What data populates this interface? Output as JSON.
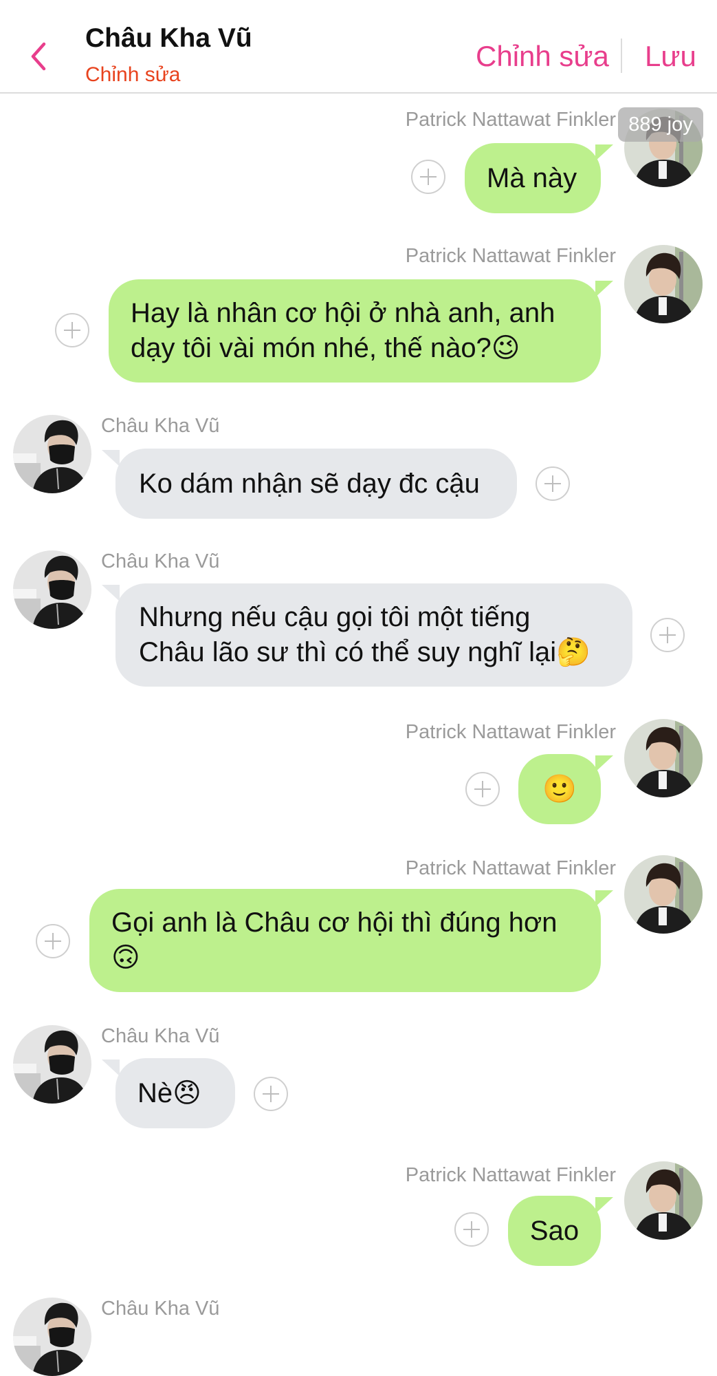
{
  "header": {
    "back_icon": "chevron-left-icon",
    "title": "Châu Kha Vũ",
    "subtitle": "Chỉnh sửa",
    "edit_label": "Chỉnh sửa",
    "save_label": "Lưu",
    "accent_color": "#e83e8c",
    "subtitle_color": "#e8431e"
  },
  "colors": {
    "bubble_self": "#bdf08d",
    "bubble_other": "#e6e8eb",
    "sender_name": "#9a9a9a"
  },
  "watermark": "889 joy",
  "messages": [
    {
      "side": "right",
      "sender": "Patrick Nattawat Finkler",
      "text": "Mà này"
    },
    {
      "side": "right",
      "sender": "Patrick Nattawat Finkler",
      "lines": [
        "Hay là nhân cơ hội ở nhà anh,  anh",
        "dạy tôi vài món nhé, thế nào?😉"
      ]
    },
    {
      "side": "left",
      "sender": "Châu Kha Vũ",
      "text": "Ko dám nhận sẽ dạy đc cậu"
    },
    {
      "side": "left",
      "sender": "Châu Kha Vũ",
      "lines": [
        "Nhưng nếu cậu gọi tôi một tiếng",
        "Châu lão sư thì có thể suy nghĩ lại🤔"
      ]
    },
    {
      "side": "right",
      "sender": "Patrick Nattawat Finkler",
      "text": "🙂"
    },
    {
      "side": "right",
      "sender": "Patrick Nattawat Finkler",
      "lines": [
        "Gọi anh là Châu cơ hội thì đúng hơn",
        "🙃"
      ]
    },
    {
      "side": "left",
      "sender": "Châu Kha Vũ",
      "text": "Nè😠"
    },
    {
      "side": "right",
      "sender": "Patrick Nattawat Finkler",
      "text": "Sao"
    },
    {
      "side": "left",
      "sender": "Châu Kha Vũ"
    }
  ]
}
